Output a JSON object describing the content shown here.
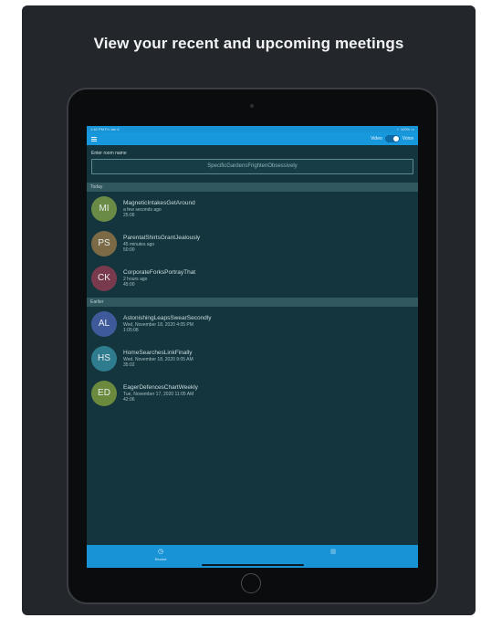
{
  "headline": "View your recent and upcoming meetings",
  "status_bar": {
    "left": "1:40 PM  Fri Jan 8",
    "right": "✓ 100% ▭"
  },
  "nav": {
    "video_label": "Video",
    "voice_label": "Voice"
  },
  "room": {
    "label": "Enter room name",
    "value": "SpecificGardensFrightenObsessively"
  },
  "sections": [
    {
      "title": "Today",
      "items": [
        {
          "initials": "MI",
          "name": "MagneticIntakesGetAround",
          "when": "a few seconds ago",
          "duration": "25:06",
          "color": "#6a8b45"
        },
        {
          "initials": "PS",
          "name": "ParentalShirtsGrantJealously",
          "when": "45 minutes ago",
          "duration": "50:00",
          "color": "#7b6a45"
        },
        {
          "initials": "CK",
          "name": "CorporateForksPortrayThat",
          "when": "2 hours ago",
          "duration": "45:00",
          "color": "#7a3a4e"
        }
      ]
    },
    {
      "title": "Earlier",
      "items": [
        {
          "initials": "AL",
          "name": "AstonishingLeapsSwearSecondly",
          "when": "Wed, November 18, 2020 4:05 PM",
          "duration": "1:05:08",
          "color": "#3f5a9a"
        },
        {
          "initials": "HS",
          "name": "HomeSearchesLinkFinally",
          "when": "Wed, November 18, 2020 9:05 AM",
          "duration": "35:02",
          "color": "#2f7c8e"
        },
        {
          "initials": "ED",
          "name": "EagerDefencesChartWeekly",
          "when": "Tue, November 17, 2020 11:05 AM",
          "duration": "42:06",
          "color": "#6c8a3e"
        }
      ]
    }
  ],
  "tabs": [
    {
      "label": "Recent",
      "icon": "clock-icon",
      "active": true
    },
    {
      "label": "",
      "icon": "calendar-icon",
      "active": false
    }
  ]
}
